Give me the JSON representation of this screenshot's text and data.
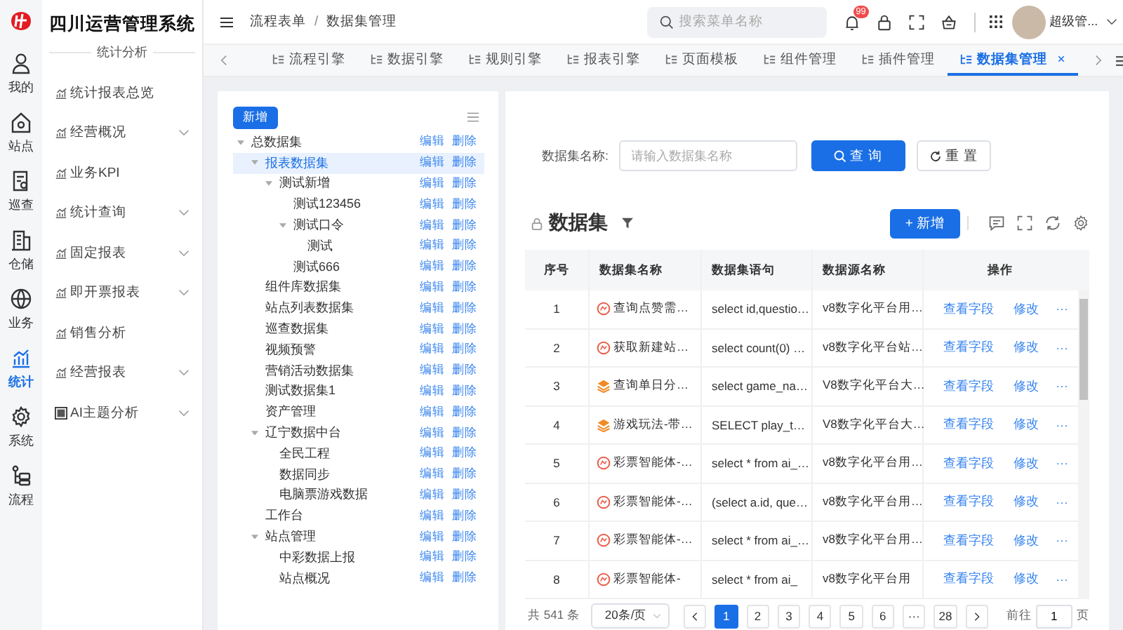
{
  "app": {
    "title": "四川运营管理系统",
    "section": "统计分析"
  },
  "rail": [
    {
      "label": "我的",
      "selected": false
    },
    {
      "label": "站点",
      "selected": false
    },
    {
      "label": "巡查",
      "selected": false
    },
    {
      "label": "仓储",
      "selected": false
    },
    {
      "label": "业务",
      "selected": false
    },
    {
      "label": "统计",
      "selected": true
    },
    {
      "label": "系统",
      "selected": false
    },
    {
      "label": "流程",
      "selected": false
    }
  ],
  "sidebar": {
    "items": [
      {
        "label": "统计报表总览",
        "kind": "chart"
      },
      {
        "label": "经营概况",
        "kind": "chart",
        "expanded": false
      },
      {
        "label": "业务KPI",
        "kind": "chart"
      },
      {
        "label": "统计查询",
        "kind": "chart",
        "expanded": false
      },
      {
        "label": "固定报表",
        "kind": "chart",
        "expanded": false
      },
      {
        "label": "即开票报表",
        "kind": "chart",
        "expanded": false
      },
      {
        "label": "销售分析",
        "kind": "chart"
      },
      {
        "label": "经营报表",
        "kind": "chart",
        "expanded": false
      },
      {
        "label": "AI主题分析",
        "kind": "ai",
        "expanded": false
      }
    ]
  },
  "header": {
    "breadcrumb": [
      "流程表单",
      "数据集管理"
    ],
    "separator": "/",
    "search": {
      "placeholder": "搜索菜单名称"
    },
    "notification_count": "99",
    "user": "超级管..."
  },
  "tabs": [
    {
      "label": "流程引擎",
      "selected": false
    },
    {
      "label": "数据引擎",
      "selected": false
    },
    {
      "label": "规则引擎",
      "selected": false
    },
    {
      "label": "报表引擎",
      "selected": false
    },
    {
      "label": "页面模板",
      "selected": false
    },
    {
      "label": "组件管理",
      "selected": false
    },
    {
      "label": "插件管理",
      "selected": false
    },
    {
      "label": "数据集管理",
      "selected": true
    }
  ],
  "tree_panel": {
    "add_button": "新增",
    "tree": [
      {
        "label": "总数据集",
        "selected": false,
        "expanded": true,
        "actions": [
          "编辑",
          "删除"
        ],
        "children": [
          {
            "label": "报表数据集",
            "selected": true,
            "expanded": true,
            "actions": [
              "编辑",
              "删除"
            ],
            "children": [
              {
                "label": "测试新增",
                "selected": false,
                "expanded": true,
                "actions": [
                  "编辑",
                  "删除"
                ],
                "children": [
                  {
                    "label": "测试123456",
                    "selected": false,
                    "actions": [
                      "编辑",
                      "删除"
                    ]
                  },
                  {
                    "label": "测试口令",
                    "selected": false,
                    "expanded": true,
                    "actions": [
                      "编辑",
                      "删除"
                    ],
                    "children": [
                      {
                        "label": "测试",
                        "selected": false,
                        "actions": [
                          "编辑",
                          "删除"
                        ]
                      }
                    ]
                  },
                  {
                    "label": "测试666",
                    "selected": false,
                    "actions": [
                      "编辑",
                      "删除"
                    ]
                  }
                ]
              }
            ]
          },
          {
            "label": "组件库数据集",
            "selected": false,
            "actions": [
              "编辑",
              "删除"
            ]
          },
          {
            "label": "站点列表数据集",
            "selected": false,
            "actions": [
              "编辑",
              "删除"
            ]
          },
          {
            "label": "巡查数据集",
            "selected": false,
            "actions": [
              "编辑",
              "删除"
            ]
          },
          {
            "label": "视频预警",
            "selected": false,
            "actions": [
              "编辑",
              "删除"
            ]
          },
          {
            "label": "营销活动数据集",
            "selected": false,
            "actions": [
              "编辑",
              "删除"
            ]
          },
          {
            "label": "测试数据集1",
            "selected": false,
            "actions": [
              "编辑",
              "删除"
            ]
          },
          {
            "label": "资产管理",
            "selected": false,
            "actions": [
              "编辑",
              "删除"
            ]
          },
          {
            "label": "辽宁数据中台",
            "selected": false,
            "expanded": true,
            "actions": [
              "编辑",
              "删除"
            ],
            "children": [
              {
                "label": "全民工程",
                "selected": false,
                "actions": [
                  "编辑",
                  "删除"
                ]
              },
              {
                "label": "数据同步",
                "selected": false,
                "actions": [
                  "编辑",
                  "删除"
                ]
              },
              {
                "label": "电脑票游戏数据",
                "selected": false,
                "actions": [
                  "编辑",
                  "删除"
                ]
              }
            ]
          },
          {
            "label": "工作台",
            "selected": false,
            "actions": [
              "编辑",
              "删除"
            ]
          },
          {
            "label": "站点管理",
            "selected": false,
            "expanded": true,
            "actions": [
              "编辑",
              "删除"
            ],
            "children": [
              {
                "label": "中彩数据上报",
                "selected": false,
                "actions": [
                  "编辑",
                  "删除"
                ]
              },
              {
                "label": "站点概况",
                "selected": false,
                "actions": [
                  "编辑",
                  "删除"
                ]
              }
            ]
          }
        ]
      }
    ]
  },
  "filter": {
    "label": "数据集名称:",
    "placeholder": "请输入数据集名称",
    "search_button": "查 询",
    "reset_button": "重 置"
  },
  "table_panel": {
    "title": "数据集",
    "add_button": "+ 新增",
    "columns": [
      "序号",
      "数据集名称",
      "数据集语句",
      "数据源名称",
      "操作"
    ],
    "rows": [
      {
        "index": "1",
        "kind": "ring",
        "name": "查询点赞需…",
        "statement": "select id,questio…",
        "source": "v8数字化平台用…",
        "actions": [
          "查看字段",
          "修改",
          "···"
        ]
      },
      {
        "index": "2",
        "kind": "ring",
        "name": "获取新建站…",
        "statement": "select count(0) …",
        "source": "v8数字化平台站…",
        "actions": [
          "查看字段",
          "修改",
          "···"
        ]
      },
      {
        "index": "3",
        "kind": "layers",
        "name": "查询单日分…",
        "statement": "select game_na…",
        "source": "V8数字化平台大…",
        "actions": [
          "查看字段",
          "修改",
          "···"
        ]
      },
      {
        "index": "4",
        "kind": "layers",
        "name": "游戏玩法-带…",
        "statement": "SELECT play_t…",
        "source": "V8数字化平台大…",
        "actions": [
          "查看字段",
          "修改",
          "···"
        ]
      },
      {
        "index": "5",
        "kind": "ring",
        "name": "彩票智能体-…",
        "statement": "select * from ai_…",
        "source": "v8数字化平台用…",
        "actions": [
          "查看字段",
          "修改",
          "···"
        ]
      },
      {
        "index": "6",
        "kind": "ring",
        "name": "彩票智能体-…",
        "statement": "(select a.id, que…",
        "source": "v8数字化平台用…",
        "actions": [
          "查看字段",
          "修改",
          "···"
        ]
      },
      {
        "index": "7",
        "kind": "ring",
        "name": "彩票智能体-…",
        "statement": "select * from ai_…",
        "source": "v8数字化平台用…",
        "actions": [
          "查看字段",
          "修改",
          "···"
        ]
      },
      {
        "index": "8",
        "kind": "ring",
        "name": "彩票智能体-",
        "statement": "select * from ai_",
        "source": "v8数字化平台用",
        "actions": [
          "查看字段",
          "修改",
          "···"
        ]
      }
    ]
  },
  "pagination": {
    "total": "共 541 条",
    "page_size": "20条/页",
    "pages": [
      {
        "label": "1",
        "selected": true
      },
      {
        "label": "2",
        "selected": false
      },
      {
        "label": "3",
        "selected": false
      },
      {
        "label": "4",
        "selected": false
      },
      {
        "label": "5",
        "selected": false
      },
      {
        "label": "6",
        "selected": false
      },
      {
        "label": "···",
        "selected": false
      },
      {
        "label": "28",
        "selected": false
      }
    ],
    "goto_label": "前往",
    "goto_value": "1",
    "goto_suffix": "页"
  }
}
